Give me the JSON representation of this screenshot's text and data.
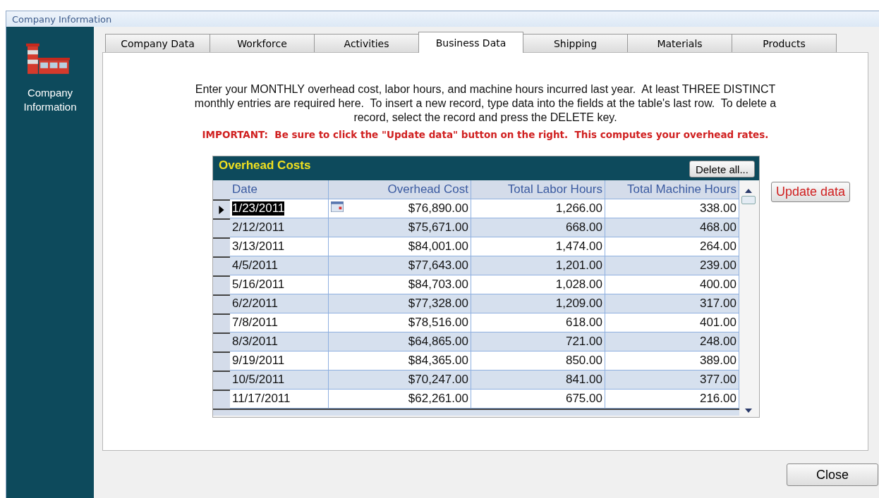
{
  "window": {
    "title": "Company Information"
  },
  "sidebar": {
    "label": "Company Information"
  },
  "tabs": [
    {
      "label": "Company Data",
      "selected": false
    },
    {
      "label": "Workforce",
      "selected": false
    },
    {
      "label": "Activities",
      "selected": false
    },
    {
      "label": "Business Data",
      "selected": true
    },
    {
      "label": "Shipping",
      "selected": false
    },
    {
      "label": "Materials",
      "selected": false
    },
    {
      "label": "Products",
      "selected": false
    }
  ],
  "instructions": "Enter your MONTHLY overhead cost, labor hours, and machine hours incurred last year.  At least THREE DISTINCT monthly entries are required here.  To insert a new record, type data into the fields at the table's last row.  To delete a record, select the record and press the DELETE key.",
  "important": "IMPORTANT:  Be sure to click the \"Update data\" button on the right.  This computes your overhead rates.",
  "table": {
    "title": "Overhead Costs",
    "delete_button": "Delete all...",
    "columns": [
      "Date",
      "Overhead Cost",
      "Total Labor Hours",
      "Total Machine Hours"
    ],
    "rows": [
      {
        "selected": true,
        "cells": [
          "1/23/2011",
          "$76,890.00",
          "1,266.00",
          "338.00"
        ]
      },
      {
        "selected": false,
        "cells": [
          "2/12/2011",
          "$75,671.00",
          "668.00",
          "468.00"
        ]
      },
      {
        "selected": false,
        "cells": [
          "3/13/2011",
          "$84,001.00",
          "1,474.00",
          "264.00"
        ]
      },
      {
        "selected": false,
        "cells": [
          "4/5/2011",
          "$77,643.00",
          "1,201.00",
          "239.00"
        ]
      },
      {
        "selected": false,
        "cells": [
          "5/16/2011",
          "$84,703.00",
          "1,028.00",
          "400.00"
        ]
      },
      {
        "selected": false,
        "cells": [
          "6/2/2011",
          "$77,328.00",
          "1,209.00",
          "317.00"
        ]
      },
      {
        "selected": false,
        "cells": [
          "7/8/2011",
          "$78,516.00",
          "618.00",
          "401.00"
        ]
      },
      {
        "selected": false,
        "cells": [
          "8/3/2011",
          "$64,865.00",
          "721.00",
          "248.00"
        ]
      },
      {
        "selected": false,
        "cells": [
          "9/19/2011",
          "$84,365.00",
          "850.00",
          "389.00"
        ]
      },
      {
        "selected": false,
        "cells": [
          "10/5/2011",
          "$70,247.00",
          "841.00",
          "377.00"
        ]
      },
      {
        "selected": false,
        "cells": [
          "11/17/2011",
          "$62,261.00",
          "675.00",
          "216.00"
        ]
      }
    ]
  },
  "update_button": "Update data",
  "close_button": "Close"
}
